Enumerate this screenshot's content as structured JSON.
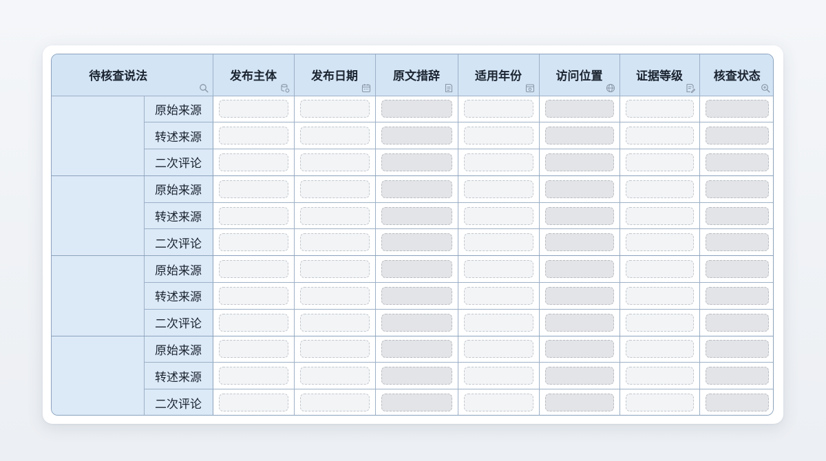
{
  "table": {
    "corner_header": "待核查说法",
    "columns": [
      {
        "label": "发布主体",
        "icon": "database-icon",
        "shade": "light"
      },
      {
        "label": "发布日期",
        "icon": "calendar-icon",
        "shade": "light"
      },
      {
        "label": "原文措辞",
        "icon": "document-icon",
        "shade": "dark"
      },
      {
        "label": "适用年份",
        "icon": "calendar-box-icon",
        "shade": "light"
      },
      {
        "label": "访问位置",
        "icon": "globe-icon",
        "shade": "dark"
      },
      {
        "label": "证据等级",
        "icon": "edit-document-icon",
        "shade": "light"
      },
      {
        "label": "核查状态",
        "icon": "search-zoom-icon",
        "shade": "dark"
      }
    ],
    "row_labels": [
      "原始来源",
      "转述来源",
      "二次评论"
    ],
    "group_count": 4
  },
  "colors": {
    "header_bg": "#d3e4f5",
    "label_bg": "#dce9f7",
    "border": "#8aa2bd",
    "placeholder_light": "#f2f4f6",
    "placeholder_dark": "#e3e4e7"
  }
}
